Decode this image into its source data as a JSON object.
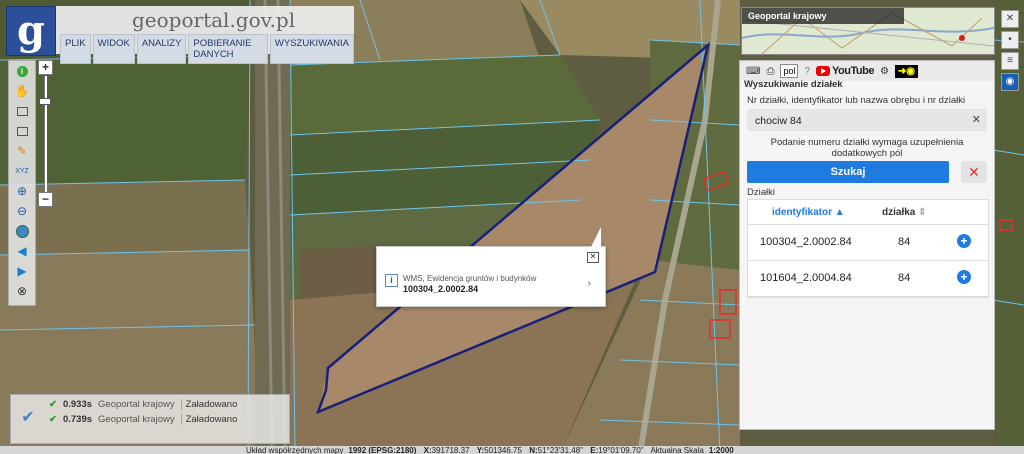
{
  "header": {
    "site_title": "geoportal.gov.pl",
    "logo_letter": "g",
    "menu": [
      "PLIK",
      "WIDOK",
      "ANALIZY",
      "POBIERANIE DANYCH",
      "WYSZUKIWANIA"
    ]
  },
  "zoom": {
    "plus": "+",
    "minus": "−"
  },
  "popup": {
    "layer": "WMS, Ewidencja gruntów i budynków",
    "parcel_id": "100304_2.0002.84",
    "info": "i",
    "close": "✕",
    "arrow": "›"
  },
  "status": {
    "rows": [
      {
        "time": "0.933s",
        "layer": "Geoportal krajowy",
        "state": "Załadowano"
      },
      {
        "time": "0.739s",
        "layer": "Geoportal krajowy",
        "state": "Załadowano"
      }
    ]
  },
  "coordbar": {
    "system": "Układ współrzędnych mapy",
    "system_value": "1992 (EPSG:2180)",
    "x_label": "X:",
    "x": "391718.37",
    "y_label": "Y:",
    "y": "501346.75",
    "n_label": "N:",
    "n": "51°23'31.48\"",
    "e_label": "E:",
    "e": "19°01'09.70\"",
    "scale_label": "Aktualna Skala",
    "scale": "1:2000"
  },
  "minimap": {
    "title": "Geoportal krajowy"
  },
  "panel": {
    "language": "pol",
    "youtube": "YouTube",
    "title": "Wyszukiwanie działek",
    "label": "Nr działki, identyfikator lub nazwa obrębu i nr działki",
    "search_value": "chociw 84",
    "notice": "Podanie numeru działki wymaga uzupełnienia dodatkowych pól",
    "search_button": "Szukaj",
    "results_label": "Działki",
    "col_id": "identyfikator",
    "col_parcel": "działka",
    "results": [
      {
        "id": "100304_2.0002.84",
        "parcel": "84"
      },
      {
        "id": "101604_2.0004.84",
        "parcel": "84"
      }
    ]
  },
  "colors": {
    "brand": "#2b4f98",
    "accent": "#1f7be0",
    "parcel_outline": "#1a1f7a",
    "cadastral_lines": "#6fc3ea"
  }
}
